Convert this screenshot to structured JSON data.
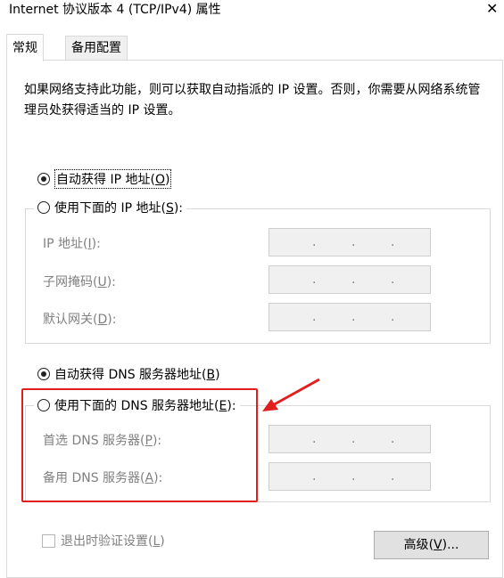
{
  "window": {
    "title": "Internet 协议版本 4 (TCP/IPv4) 属性",
    "close_icon": "close-icon"
  },
  "tabs": [
    {
      "label": "常规",
      "active": true
    },
    {
      "label": "备用配置",
      "active": false
    }
  ],
  "description": "如果网络支持此功能，则可以获取自动指派的 IP 设置。否则，你需要从网络系统管理员处获得适当的 IP 设置。",
  "ip": {
    "auto": {
      "text": "自动获得 IP 地址",
      "key": "O",
      "checked": true
    },
    "manual": {
      "text": "使用下面的 IP 地址",
      "key": "S",
      "checked": false
    },
    "fields": [
      {
        "label": "IP 地址",
        "key": "I",
        "value": ". . ."
      },
      {
        "label": "子网掩码",
        "key": "U",
        "value": ". . ."
      },
      {
        "label": "默认网关",
        "key": "D",
        "value": ". . ."
      }
    ]
  },
  "dns": {
    "auto": {
      "text": "自动获得 DNS 服务器地址",
      "key": "B",
      "checked": true
    },
    "manual": {
      "text": "使用下面的 DNS 服务器地址",
      "key": "E",
      "checked": false
    },
    "fields": [
      {
        "label": "首选 DNS 服务器",
        "key": "P",
        "value": ". . ."
      },
      {
        "label": "备用 DNS 服务器",
        "key": "A",
        "value": ". . ."
      }
    ]
  },
  "validate": {
    "label": "退出时验证设置",
    "key": "L",
    "checked": false,
    "enabled": false
  },
  "advanced_button": {
    "label": "高级",
    "key": "V",
    "suffix": "..."
  },
  "annotation": {
    "highlight_color": "#e0201e"
  }
}
